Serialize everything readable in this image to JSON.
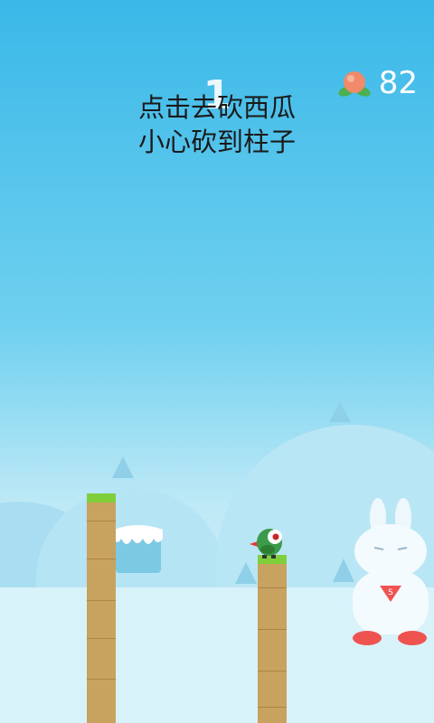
{
  "game": {
    "score": "1",
    "hint_line1": "点击去砍西瓜",
    "hint_line2": "小心砍到柱子",
    "coin_count": "82",
    "coin_icon": "peach-icon",
    "player_icon": "ninja-bird-icon",
    "rabbit_icon": "super-rabbit-icon"
  },
  "colors": {
    "sky_top": "#3ab8e8",
    "sky_bottom": "#d7f3fb",
    "pillar": "#c8a25f",
    "grass": "#7fcf3a",
    "peach": "#f08a6a"
  }
}
